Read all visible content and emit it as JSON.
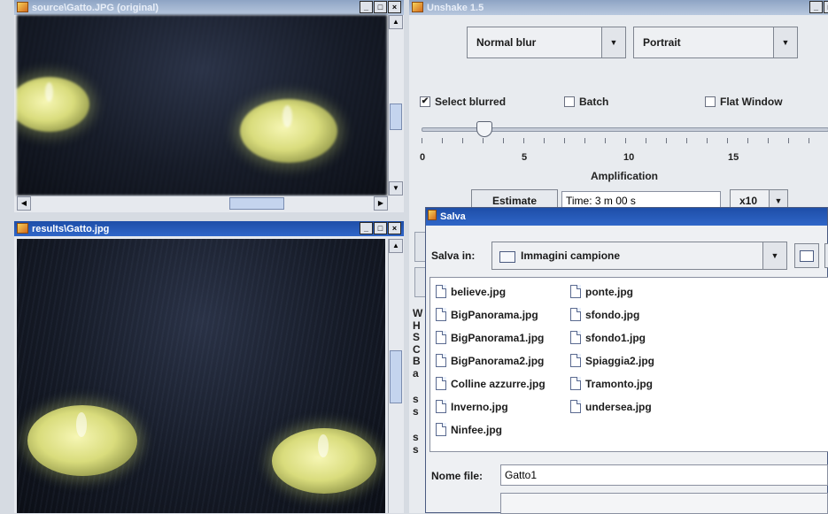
{
  "source_window": {
    "title": "source\\Gatto.JPG (original)"
  },
  "results_window": {
    "title": "results\\Gatto.jpg"
  },
  "unshake": {
    "title": "Unshake 1.5",
    "blur_type": "Normal blur",
    "orientation": "Portrait",
    "select_blurred_label": "Select blurred",
    "select_blurred_checked": true,
    "batch_label": "Batch",
    "flat_window_label": "Flat Window",
    "slider_ticks": [
      "0",
      "5",
      "10",
      "15"
    ],
    "slider_value": 2,
    "slider_label": "Amplification",
    "estimate_label": "Estimate",
    "time_label": "Time: 3 m 00 s",
    "multiplier": "x10",
    "side_letters": [
      "W",
      "H",
      "S",
      "C",
      "B",
      "a",
      "s",
      "s",
      "s",
      "s"
    ]
  },
  "salva": {
    "title": "Salva",
    "salva_in_label": "Salva in:",
    "folder": "Immagini campione",
    "files_col1": [
      "believe.jpg",
      "BigPanorama.jpg",
      "BigPanorama1.jpg",
      "BigPanorama2.jpg",
      "Colline azzurre.jpg",
      "Inverno.jpg",
      "Ninfee.jpg"
    ],
    "files_col2": [
      "ponte.jpg",
      "sfondo.jpg",
      "sfondo1.jpg",
      "Spiaggia2.jpg",
      "Tramonto.jpg",
      "undersea.jpg"
    ],
    "nome_file_label": "Nome file:",
    "nome_file_value": "Gatto1"
  },
  "icons": {
    "frame_icon": "java-cup-icon",
    "minimize": "minimize-icon",
    "maximize": "maximize-icon",
    "close": "close-icon"
  }
}
